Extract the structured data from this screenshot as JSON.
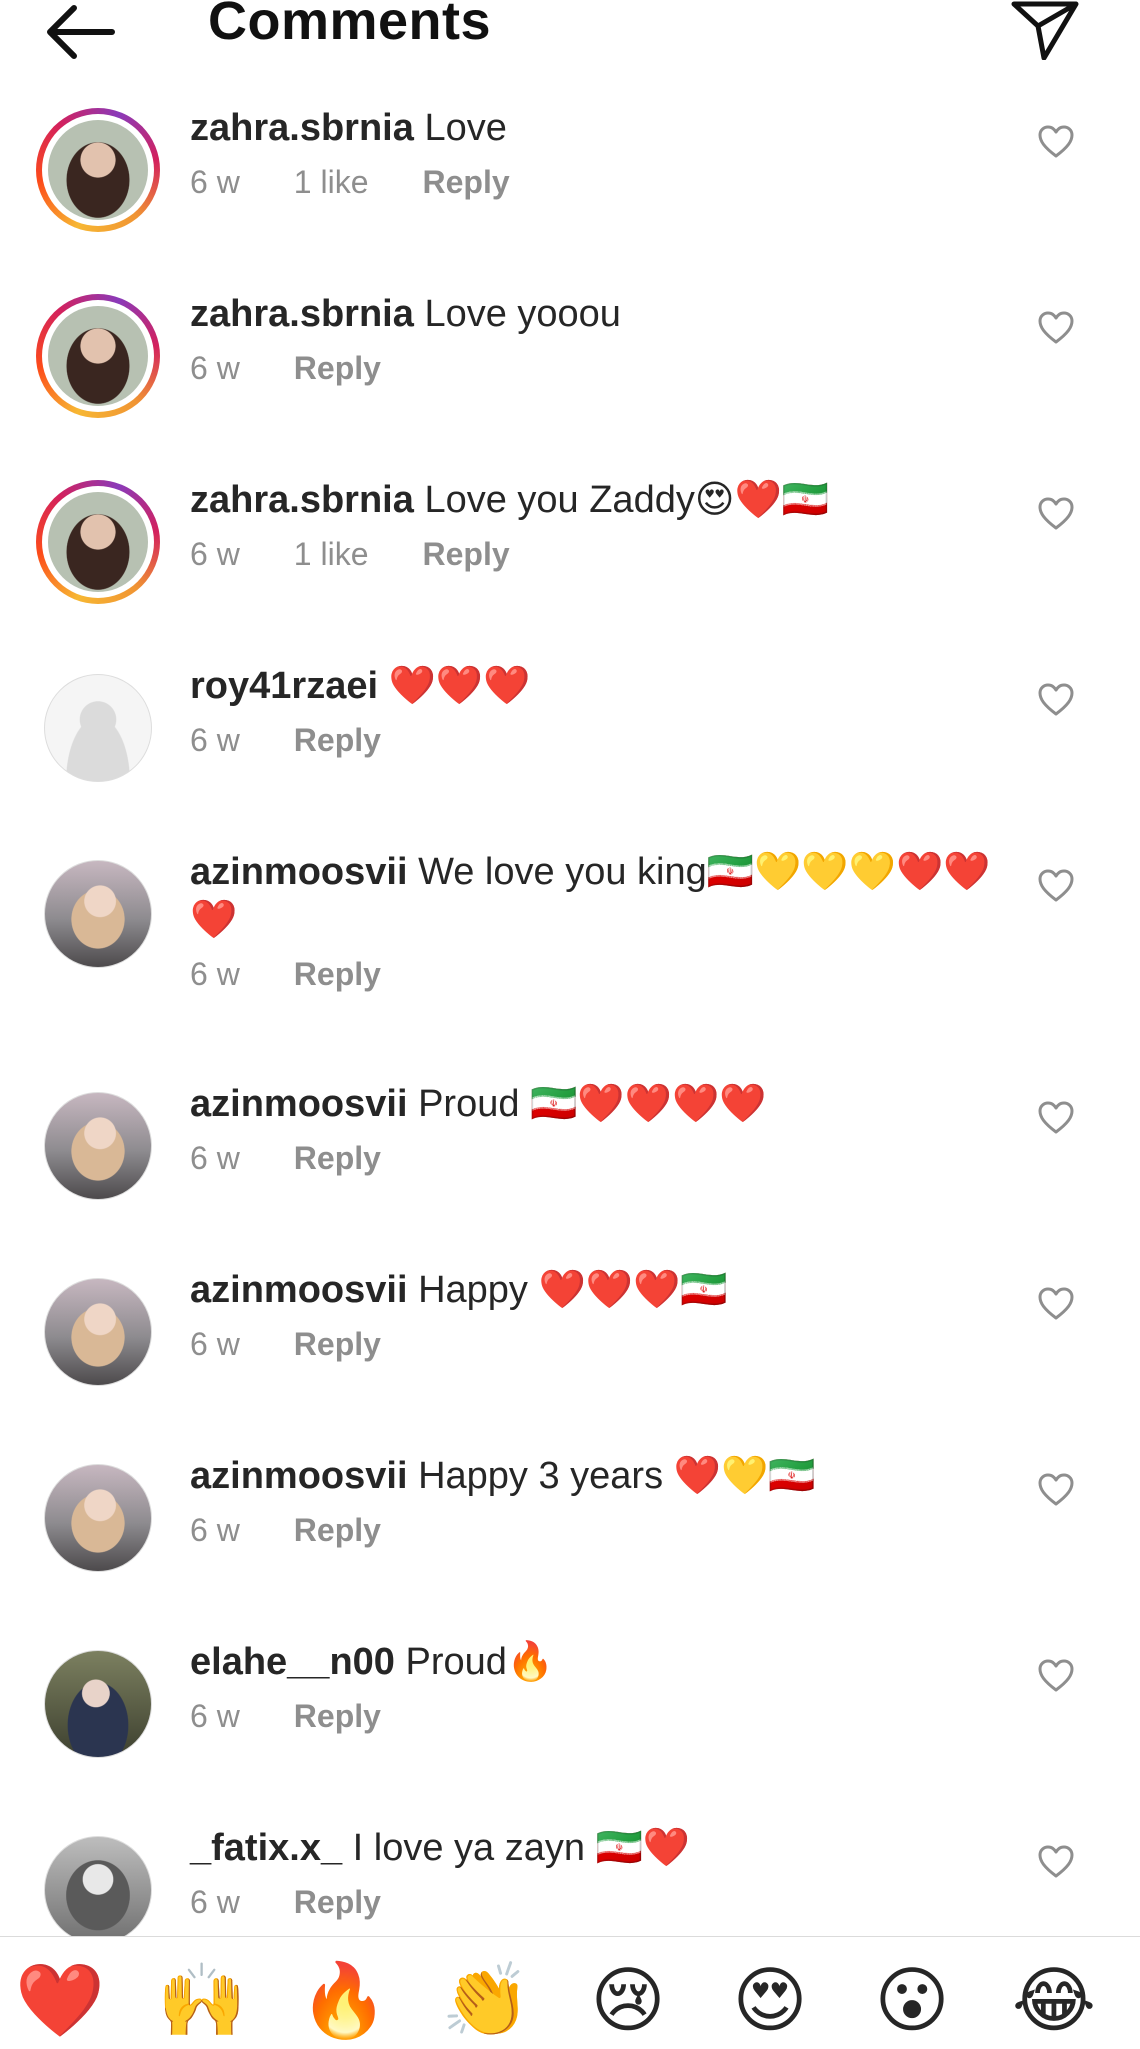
{
  "header": {
    "title": "Comments",
    "back_icon": "back-arrow-icon",
    "share_icon": "paper-plane-icon"
  },
  "comments": [
    {
      "username": "zahra.sbrnia",
      "text": "Love",
      "age": "6 w",
      "likes": "1 like",
      "reply": "Reply",
      "avatar": "pic-zahra",
      "story": true
    },
    {
      "username": "zahra.sbrnia",
      "text": "Love yooou",
      "age": "6 w",
      "likes": "",
      "reply": "Reply",
      "avatar": "pic-zahra",
      "story": true
    },
    {
      "username": "zahra.sbrnia",
      "text": "Love you Zaddy😍❤️🇮🇷",
      "age": "6 w",
      "likes": "1 like",
      "reply": "Reply",
      "avatar": "pic-zahra",
      "story": true
    },
    {
      "username": "roy41rzaei",
      "text": "❤️❤️❤️",
      "age": "6 w",
      "likes": "",
      "reply": "Reply",
      "avatar": "pic-default",
      "story": false
    },
    {
      "username": "azinmoosvii",
      "text": "We love you king🇮🇷💛💛💛❤️❤️❤️",
      "age": "6 w",
      "likes": "",
      "reply": "Reply",
      "avatar": "pic-azin",
      "story": false
    },
    {
      "username": "azinmoosvii",
      "text": "Proud 🇮🇷❤️❤️❤️❤️",
      "age": "6 w",
      "likes": "",
      "reply": "Reply",
      "avatar": "pic-azin",
      "story": false
    },
    {
      "username": "azinmoosvii",
      "text": "Happy ❤️❤️❤️🇮🇷",
      "age": "6 w",
      "likes": "",
      "reply": "Reply",
      "avatar": "pic-azin",
      "story": false
    },
    {
      "username": "azinmoosvii",
      "text": "Happy 3 years ❤️💛🇮🇷",
      "age": "6 w",
      "likes": "",
      "reply": "Reply",
      "avatar": "pic-azin",
      "story": false
    },
    {
      "username": "elahe__n00",
      "text": "Proud🔥",
      "age": "6 w",
      "likes": "",
      "reply": "Reply",
      "avatar": "pic-elahe",
      "story": false
    },
    {
      "username": "_fatix.x_",
      "text": "I love ya zayn 🇮🇷❤️",
      "age": "6 w",
      "likes": "",
      "reply": "Reply",
      "avatar": "pic-fatix",
      "story": false
    }
  ],
  "emoji_bar": [
    {
      "emoji": "❤️",
      "name": "red-heart"
    },
    {
      "emoji": "🙌",
      "name": "raising-hands"
    },
    {
      "emoji": "🔥",
      "name": "fire"
    },
    {
      "emoji": "👏",
      "name": "clapping-hands"
    },
    {
      "emoji": "😢",
      "name": "crying-face"
    },
    {
      "emoji": "😍",
      "name": "heart-eyes"
    },
    {
      "emoji": "😮",
      "name": "surprised-face"
    },
    {
      "emoji": "😂",
      "name": "tears-of-joy"
    }
  ],
  "colors": {
    "text": "#262626",
    "meta": "#8e8e8e",
    "divider": "#dbdbdb"
  }
}
